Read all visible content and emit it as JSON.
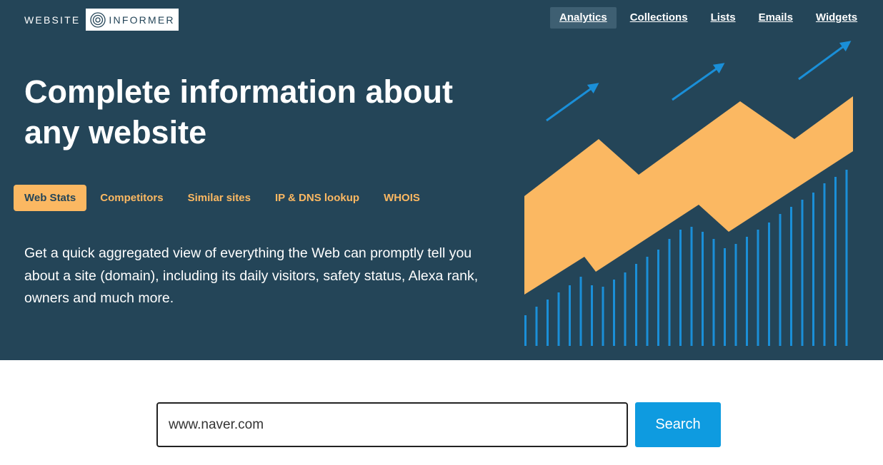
{
  "logo": {
    "left_text": "WEBSITE",
    "right_text": "INFORMER"
  },
  "nav": {
    "items": [
      {
        "label": "Analytics"
      },
      {
        "label": "Collections"
      },
      {
        "label": "Lists"
      },
      {
        "label": "Emails"
      },
      {
        "label": "Widgets"
      }
    ],
    "active": "Analytics"
  },
  "hero": {
    "headline_line1": "Complete information about",
    "headline_line2": "any website",
    "tabs": [
      {
        "label": "Web Stats"
      },
      {
        "label": "Competitors"
      },
      {
        "label": "Similar sites"
      },
      {
        "label": "IP & DNS lookup"
      },
      {
        "label": "WHOIS"
      }
    ],
    "active_tab": "Web Stats",
    "description": "Get a quick aggregated view of everything the Web can promptly tell you about a site (domain), including its daily visitors, safety status, Alexa rank, owners and much more."
  },
  "search": {
    "value": "www.naver.com",
    "button_label": "Search"
  },
  "colors": {
    "hero_bg": "#244558",
    "accent_orange": "#fbb862",
    "accent_blue": "#1a8fd8",
    "button_blue": "#0e9be0"
  }
}
